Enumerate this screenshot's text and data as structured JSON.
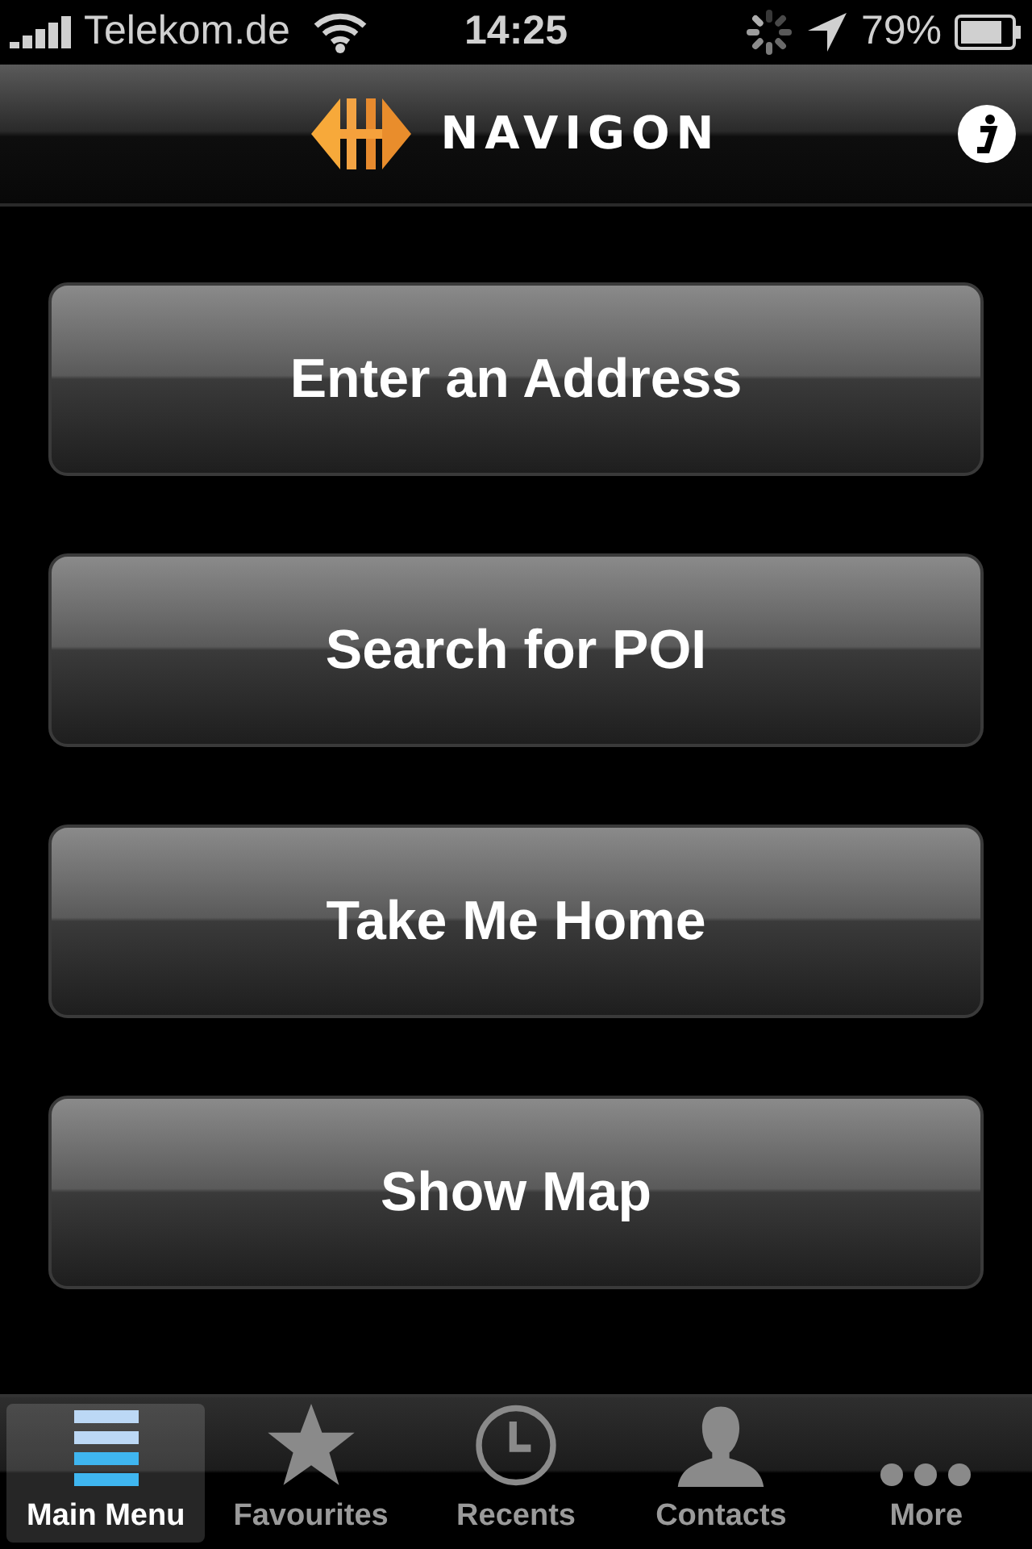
{
  "status_bar": {
    "carrier": "Telekom.de",
    "time": "14:25",
    "battery": "79%"
  },
  "header": {
    "title": "NAVIGON"
  },
  "menu": [
    "Enter an Address",
    "Search for POI",
    "Take Me Home",
    "Show Map"
  ],
  "tabs": [
    {
      "label": "Main Menu",
      "kind": "menu",
      "selected": true
    },
    {
      "label": "Favourites",
      "kind": "star",
      "selected": false
    },
    {
      "label": "Recents",
      "kind": "clock",
      "selected": false
    },
    {
      "label": "Contacts",
      "kind": "person",
      "selected": false
    },
    {
      "label": "More",
      "kind": "more",
      "selected": false
    }
  ]
}
